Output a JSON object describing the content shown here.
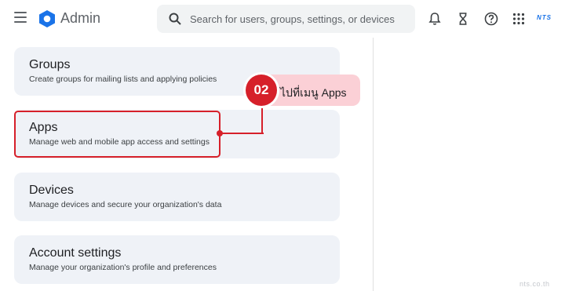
{
  "header": {
    "app_title": "Admin",
    "search_placeholder": "Search for users, groups, settings, or devices",
    "brand": "NTS",
    "icons": [
      "menu-icon",
      "admin-logo-icon",
      "search-icon",
      "bell-icon",
      "hourglass-icon",
      "help-icon",
      "apps-grid-icon"
    ]
  },
  "cards": [
    {
      "title": "Groups",
      "description": "Create groups for mailing lists and applying policies"
    },
    {
      "title": "Apps",
      "description": "Manage web and mobile app access and settings"
    },
    {
      "title": "Devices",
      "description": "Manage devices and secure your organization's data"
    },
    {
      "title": "Account settings",
      "description": "Manage your organization's profile and preferences"
    }
  ],
  "annotation": {
    "step": "02",
    "text": "ไปที่เมนู Apps",
    "color": "#d6202a",
    "label_bg": "#fbd0d6"
  },
  "watermark": "nts.co.th"
}
